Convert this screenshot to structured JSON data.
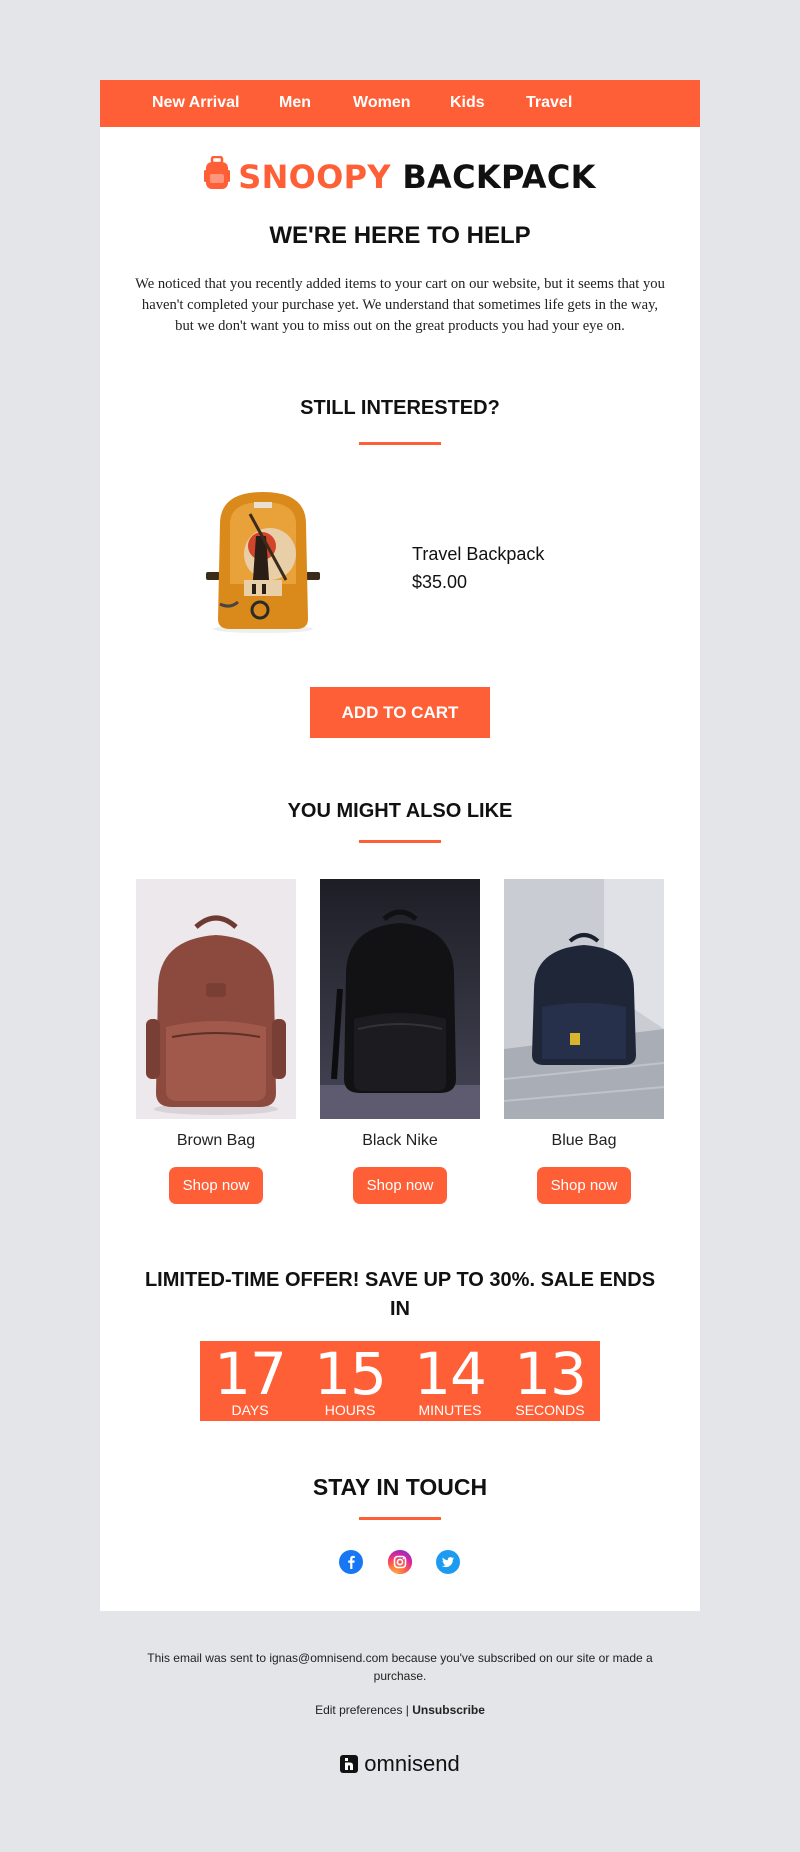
{
  "nav": {
    "items": [
      {
        "label": "New Arrival"
      },
      {
        "label": "Men"
      },
      {
        "label": "Women"
      },
      {
        "label": "Kids"
      },
      {
        "label": "Travel"
      }
    ]
  },
  "brand": {
    "name_accent": "SNOOPY",
    "name_rest": "BACKPACK",
    "icon": "backpack-icon",
    "accent_color": "#ff5f36"
  },
  "hero": {
    "title": "WE'RE HERE TO HELP",
    "text": "We noticed that you recently added items to your cart on our website, but it seems that you haven't completed your purchase yet. We understand that sometimes life gets in the way, but we don't want you to miss out on the great products you had your eye on."
  },
  "cart": {
    "title": "STILL INTERESTED?",
    "product_name": "Travel Backpack",
    "product_price": "$35.00",
    "button_label": "ADD TO CART"
  },
  "recommendations": {
    "title": "YOU MIGHT ALSO LIKE",
    "items": [
      {
        "name": "Brown Bag",
        "button": "Shop now"
      },
      {
        "name": "Black Nike",
        "button": "Shop now"
      },
      {
        "name": "Blue Bag",
        "button": "Shop now"
      }
    ]
  },
  "offer": {
    "text": "LIMITED-TIME OFFER! SAVE UP TO 30%. SALE ENDS IN",
    "countdown": [
      {
        "value": "17",
        "label": "DAYS"
      },
      {
        "value": "15",
        "label": "HOURS"
      },
      {
        "value": "14",
        "label": "MINUTES"
      },
      {
        "value": "13",
        "label": "SECONDS"
      }
    ]
  },
  "social": {
    "title": "STAY IN TOUCH",
    "icons": [
      "facebook-icon",
      "instagram-icon",
      "twitter-icon"
    ]
  },
  "footer": {
    "notice": "This email was sent to ignas@omnisend.com because you've subscribed on our site or made a purchase.",
    "edit_preferences": "Edit preferences",
    "separator": " | ",
    "unsubscribe": "Unsubscribe",
    "provider": "omnisend"
  }
}
